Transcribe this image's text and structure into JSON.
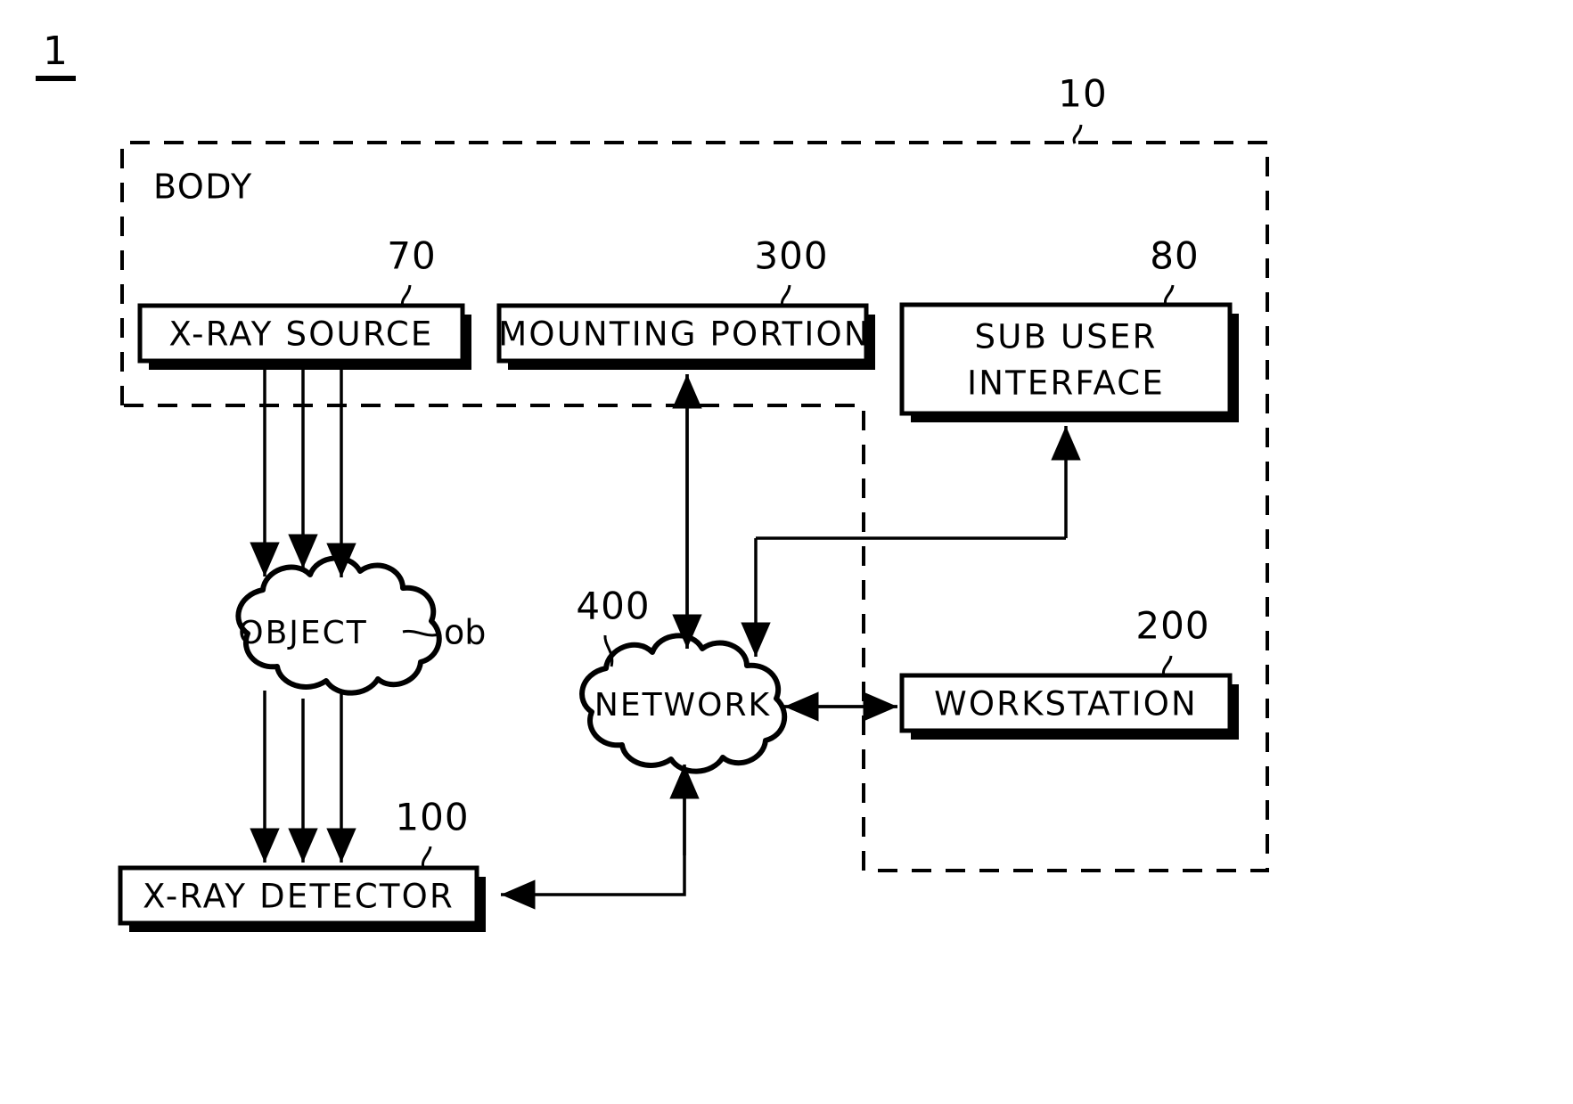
{
  "figure": {
    "number": "1"
  },
  "enclosure": {
    "body_label": "BODY",
    "body_ref": "10"
  },
  "blocks": {
    "xray_source": {
      "label": "X-RAY SOURCE",
      "ref": "70"
    },
    "mounting_portion": {
      "label": "MOUNTING PORTION",
      "ref": "300"
    },
    "sub_user_interface": {
      "label_line1": "SUB USER",
      "label_line2": "INTERFACE",
      "ref": "80"
    },
    "workstation": {
      "label": "WORKSTATION",
      "ref": "200"
    },
    "xray_detector": {
      "label": "X-RAY DETECTOR",
      "ref": "100"
    }
  },
  "clouds": {
    "object": {
      "label": "OBJECT",
      "ref": "ob"
    },
    "network": {
      "label": "NETWORK",
      "ref": "400"
    }
  },
  "colors": {
    "line": "#000000",
    "background": "#ffffff",
    "shadow": "#000000"
  }
}
